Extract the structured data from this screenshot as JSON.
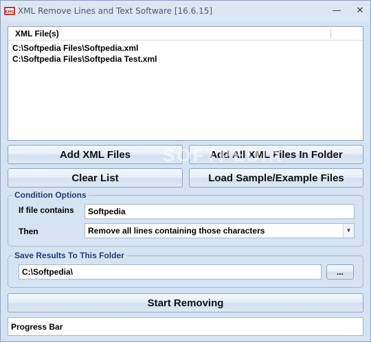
{
  "window": {
    "title": "XML Remove Lines and Text Software [16.6.15]",
    "minimize_glyph": "—",
    "close_glyph": "✕"
  },
  "file_list": {
    "column_header": "XML File(s)",
    "items": [
      "C:\\Softpedia Files\\Softpedia.xml",
      "C:\\Softpedia Files\\Softpedia Test.xml"
    ]
  },
  "buttons": {
    "add_files": "Add XML Files",
    "add_folder": "Add All XML Files In Folder",
    "clear_list": "Clear List",
    "load_sample": "Load Sample/Example Files",
    "start": "Start Removing",
    "browse": "..."
  },
  "watermark": "SOFTPEDIA",
  "conditions": {
    "legend": "Condition Options",
    "if_label": "If file contains",
    "if_value": "Softpedia",
    "then_label": "Then",
    "then_value": "Remove all lines containing those characters"
  },
  "output": {
    "legend": "Save Results To This Folder",
    "folder": "C:\\Softpedia\\"
  },
  "progress": {
    "label": "Progress Bar",
    "value": 0
  },
  "colors": {
    "legend_text": "#1e3f7a",
    "window_bg": "#d6e3f2"
  }
}
